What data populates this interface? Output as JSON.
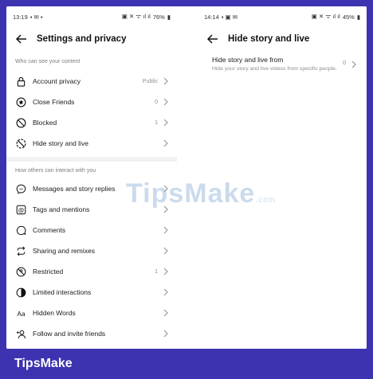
{
  "left": {
    "status": {
      "time": "13:19",
      "battery": "76%"
    },
    "title": "Settings and privacy",
    "section1": "Who can see your content",
    "items1": [
      {
        "icon": "lock-icon",
        "label": "Account privacy",
        "value": "Public"
      },
      {
        "icon": "star-circle-icon",
        "label": "Close Friends",
        "value": "0"
      },
      {
        "icon": "blocked-icon",
        "label": "Blocked",
        "value": "1"
      },
      {
        "icon": "hide-story-icon",
        "label": "Hide story and live",
        "value": ""
      }
    ],
    "section2": "How others can interact with you",
    "items2": [
      {
        "icon": "messenger-icon",
        "label": "Messages and story replies",
        "value": ""
      },
      {
        "icon": "at-sign-icon",
        "label": "Tags and mentions",
        "value": ""
      },
      {
        "icon": "comment-icon",
        "label": "Comments",
        "value": ""
      },
      {
        "icon": "remix-icon",
        "label": "Sharing and remixes",
        "value": ""
      },
      {
        "icon": "restricted-icon",
        "label": "Restricted",
        "value": "1"
      },
      {
        "icon": "limited-icon",
        "label": "Limited interactions",
        "value": ""
      },
      {
        "icon": "hidden-words-icon",
        "label": "Hidden Words",
        "value": ""
      },
      {
        "icon": "add-friend-icon",
        "label": "Follow and invite friends",
        "value": ""
      }
    ]
  },
  "right": {
    "status": {
      "time": "14:14",
      "battery": "45%"
    },
    "title": "Hide story and live",
    "item": {
      "title": "Hide story and live from",
      "subtitle": "Hide your story and live videos from specific people.",
      "value": "0"
    }
  },
  "watermark": {
    "main": "TipsMake",
    "suffix": ".com"
  },
  "footer": "TipsMake"
}
